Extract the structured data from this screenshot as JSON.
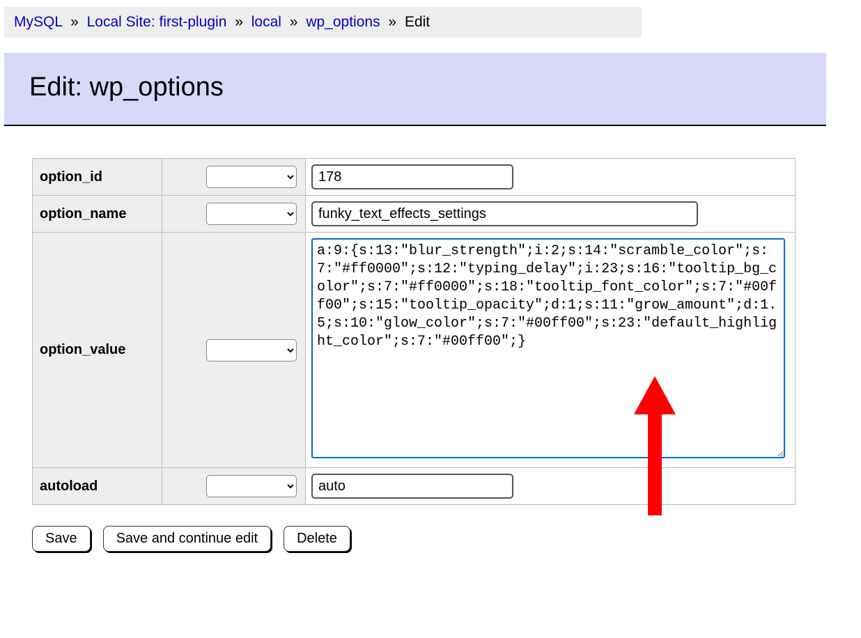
{
  "breadcrumb": {
    "items": [
      {
        "label": "MySQL"
      },
      {
        "label": "Local Site: first-plugin"
      },
      {
        "label": "local"
      },
      {
        "label": "wp_options"
      }
    ],
    "current": "Edit",
    "sep": "»"
  },
  "title": "Edit: wp_options",
  "fields": {
    "option_id": {
      "label": "option_id",
      "value": "178"
    },
    "option_name": {
      "label": "option_name",
      "value": "funky_text_effects_settings"
    },
    "option_value": {
      "label": "option_value",
      "value": "a:9:{s:13:\"blur_strength\";i:2;s:14:\"scramble_color\";s:7:\"#ff0000\";s:12:\"typing_delay\";i:23;s:16:\"tooltip_bg_color\";s:7:\"#ff0000\";s:18:\"tooltip_font_color\";s:7:\"#00ff00\";s:15:\"tooltip_opacity\";d:1;s:11:\"grow_amount\";d:1.5;s:10:\"glow_color\";s:7:\"#00ff00\";s:23:\"default_highlight_color\";s:7:\"#00ff00\";}"
    },
    "autoload": {
      "label": "autoload",
      "value": "auto"
    }
  },
  "buttons": {
    "save": "Save",
    "save_continue": "Save and continue edit",
    "delete": "Delete"
  },
  "annotation": {
    "arrow_color": "#ff0000"
  }
}
